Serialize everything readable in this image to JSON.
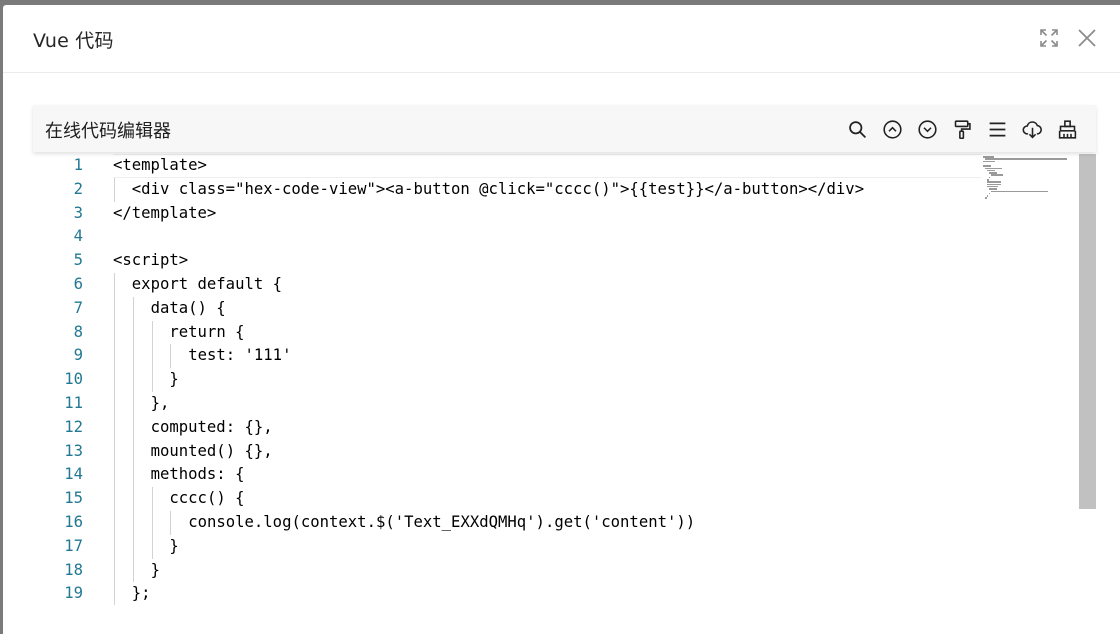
{
  "modal": {
    "title": "Vue 代码",
    "expand_icon": "expand-icon",
    "close_icon": "close-icon"
  },
  "toolbar": {
    "title": "在线代码编辑器",
    "icons": [
      "search-icon",
      "arrow-up-circle-icon",
      "arrow-down-circle-icon",
      "format-brush-icon",
      "menu-lines-icon",
      "cloud-download-icon",
      "clear-broom-icon"
    ]
  },
  "editor": {
    "current_line": 1,
    "lines": [
      {
        "num": "1",
        "indent": 0,
        "text": "<template>"
      },
      {
        "num": "2",
        "indent": 1,
        "text": "<div class=\"hex-code-view\"><a-button @click=\"cccc()\">{{test}}</a-button></div>"
      },
      {
        "num": "3",
        "indent": 0,
        "text": "</template>"
      },
      {
        "num": "4",
        "indent": 0,
        "text": ""
      },
      {
        "num": "5",
        "indent": 0,
        "text": "<script>"
      },
      {
        "num": "6",
        "indent": 1,
        "text": "export default {"
      },
      {
        "num": "7",
        "indent": 2,
        "text": "data() {"
      },
      {
        "num": "8",
        "indent": 3,
        "text": "return {"
      },
      {
        "num": "9",
        "indent": 4,
        "text": "test: '111'"
      },
      {
        "num": "10",
        "indent": 3,
        "text": "}"
      },
      {
        "num": "11",
        "indent": 2,
        "text": "},"
      },
      {
        "num": "12",
        "indent": 2,
        "text": "computed: {},"
      },
      {
        "num": "13",
        "indent": 2,
        "text": "mounted() {},"
      },
      {
        "num": "14",
        "indent": 2,
        "text": "methods: {"
      },
      {
        "num": "15",
        "indent": 3,
        "text": "cccc() {"
      },
      {
        "num": "16",
        "indent": 4,
        "text": "console.log(context.$('Text_EXXdQMHq').get('content'))"
      },
      {
        "num": "17",
        "indent": 3,
        "text": "}"
      },
      {
        "num": "18",
        "indent": 2,
        "text": "}"
      },
      {
        "num": "19",
        "indent": 1,
        "text": "};"
      }
    ]
  }
}
